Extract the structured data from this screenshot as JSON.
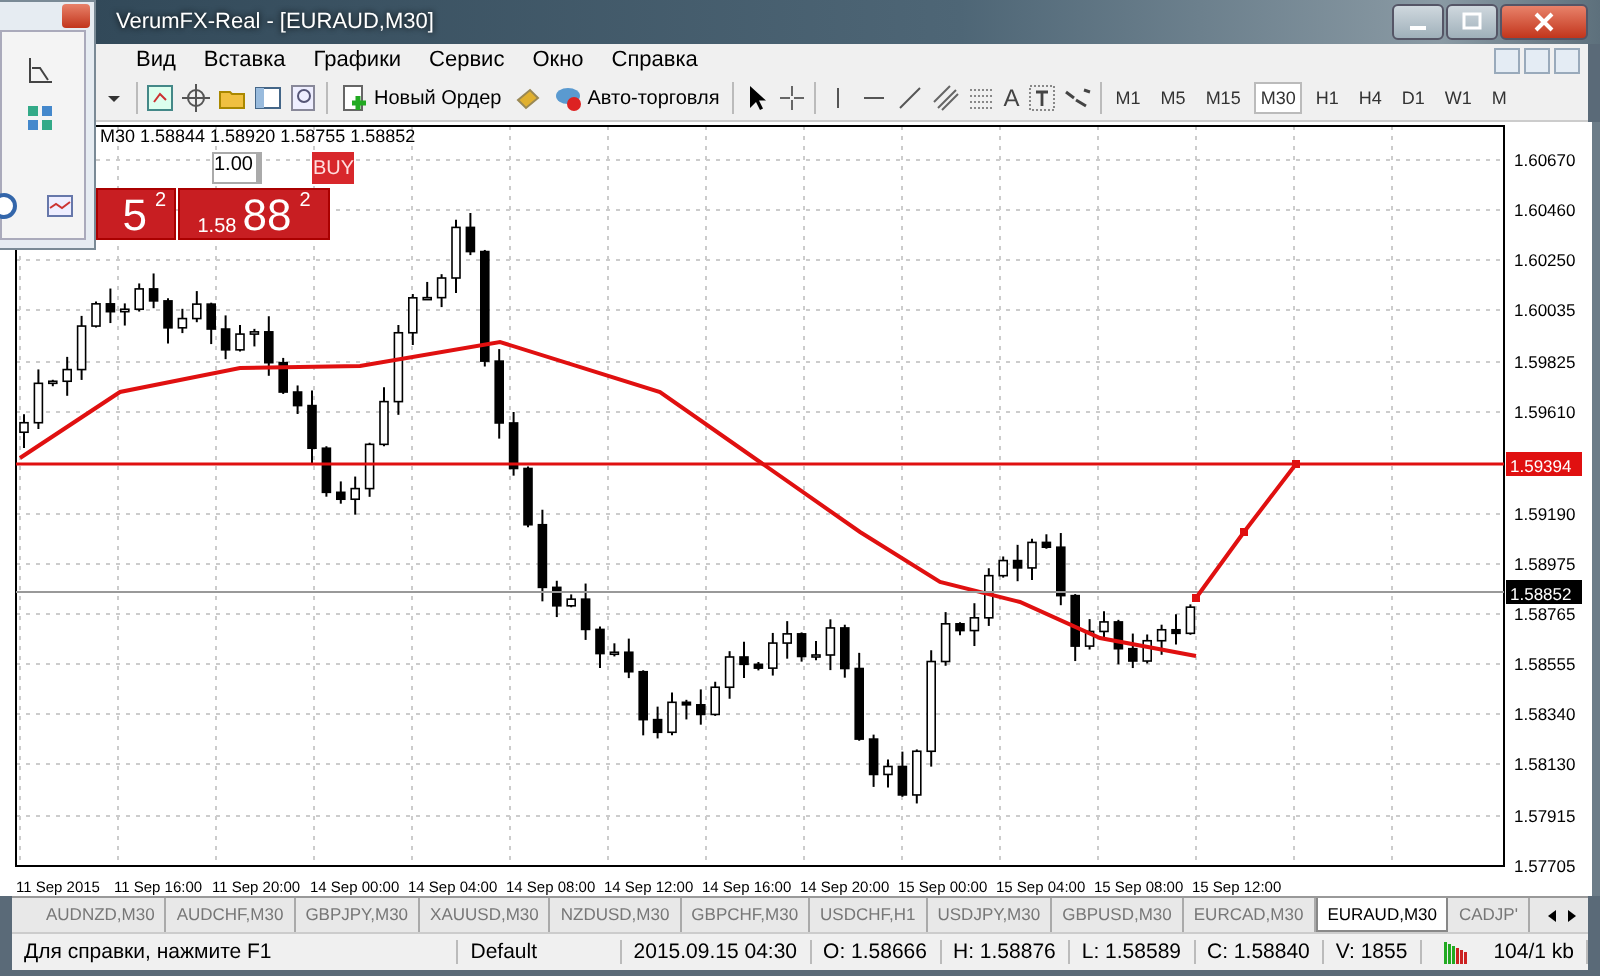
{
  "window": {
    "title": "VerumFX-Real - [EURAUD,M30]"
  },
  "menu": [
    "Вид",
    "Вставка",
    "Графики",
    "Сервис",
    "Окно",
    "Справка"
  ],
  "toolbar": {
    "new_order": "Новый Ордер",
    "auto_trading": "Авто-торговля",
    "text_tool": "A",
    "timeframes": [
      {
        "label": "M1",
        "selected": false
      },
      {
        "label": "M5",
        "selected": false
      },
      {
        "label": "M15",
        "selected": false
      },
      {
        "label": "M30",
        "selected": true
      },
      {
        "label": "H1",
        "selected": false
      },
      {
        "label": "H4",
        "selected": false
      },
      {
        "label": "D1",
        "selected": false
      },
      {
        "label": "W1",
        "selected": false
      },
      {
        "label": "M",
        "selected": false
      }
    ]
  },
  "chart": {
    "info": "M30  1.58844 1.58920 1.58755 1.58852",
    "trade_panel": {
      "volume": "1.00",
      "buy_label": "BUY",
      "sell_main": "5",
      "sell_sup": "2",
      "buy_small": "1.58",
      "buy_main": "88",
      "buy_sup": "2"
    },
    "price_labels": [
      "1.60670",
      "1.60460",
      "1.60250",
      "1.60035",
      "1.59825",
      "1.59610",
      "1.59394",
      "1.59190",
      "1.58975",
      "1.58852",
      "1.58765",
      "1.58555",
      "1.58340",
      "1.58130",
      "1.57915",
      "1.57705"
    ],
    "time_labels": [
      "11 Sep 2015",
      "11 Sep 16:00",
      "11 Sep 20:00",
      "14 Sep 00:00",
      "14 Sep 04:00",
      "14 Sep 08:00",
      "14 Sep 12:00",
      "14 Sep 16:00",
      "14 Sep 20:00",
      "15 Sep 00:00",
      "15 Sep 04:00",
      "15 Sep 08:00",
      "15 Sep 12:00"
    ]
  },
  "tabs": [
    {
      "label": "AUDNZD,M30",
      "selected": false
    },
    {
      "label": "AUDCHF,M30",
      "selected": false
    },
    {
      "label": "GBPJPY,M30",
      "selected": false
    },
    {
      "label": "XAUUSD,M30",
      "selected": false
    },
    {
      "label": "NZDUSD,M30",
      "selected": false
    },
    {
      "label": "GBPCHF,M30",
      "selected": false
    },
    {
      "label": "USDCHF,H1",
      "selected": false
    },
    {
      "label": "USDJPY,M30",
      "selected": false
    },
    {
      "label": "GBPUSD,M30",
      "selected": false
    },
    {
      "label": "EURCAD,M30",
      "selected": false
    },
    {
      "label": "EURAUD,M30",
      "selected": true
    },
    {
      "label": "CADJP'",
      "selected": false
    }
  ],
  "status_bar": [
    "Для справки, нажмите F1",
    "Default",
    "2015.09.15 04:30",
    "O: 1.58666",
    "H: 1.58876",
    "L: 1.58589",
    "C: 1.58840",
    "V: 1855",
    "104/1 kb"
  ]
}
